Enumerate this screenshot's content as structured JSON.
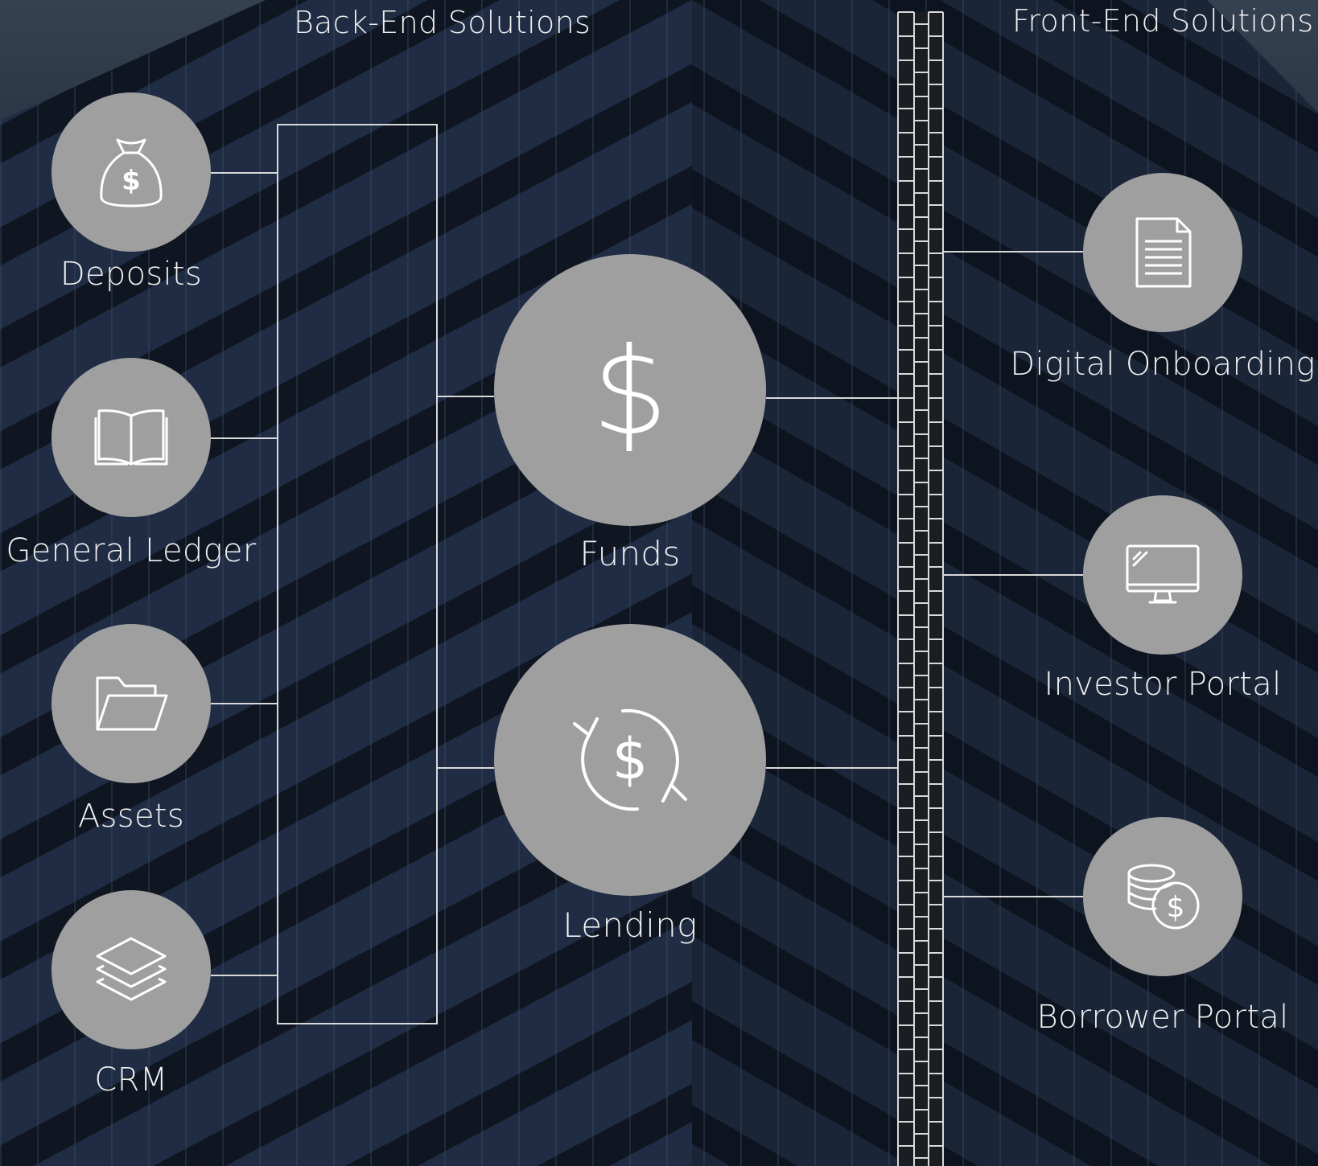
{
  "headings": {
    "back_end": "Back-End Solutions",
    "front_end": "Front-End Solutions"
  },
  "back_end_items": [
    {
      "label": "Deposits",
      "icon": "money-bag-icon"
    },
    {
      "label": "General Ledger",
      "icon": "open-book-icon"
    },
    {
      "label": "Assets",
      "icon": "folder-icon"
    },
    {
      "label": "CRM",
      "icon": "layers-icon"
    }
  ],
  "core_items": [
    {
      "label": "Funds",
      "icon": "dollar-icon"
    },
    {
      "label": "Lending",
      "icon": "circular-dollar-icon"
    }
  ],
  "front_end_items": [
    {
      "label": "Digital Onboarding",
      "icon": "document-icon"
    },
    {
      "label": "Investor Portal",
      "icon": "monitor-icon"
    },
    {
      "label": "Borrower Portal",
      "icon": "coins-icon"
    }
  ],
  "colors": {
    "circle": "#9f9f9f",
    "line": "#d9d9d9",
    "text": "#f0f0f0",
    "background": "#1d2636"
  }
}
